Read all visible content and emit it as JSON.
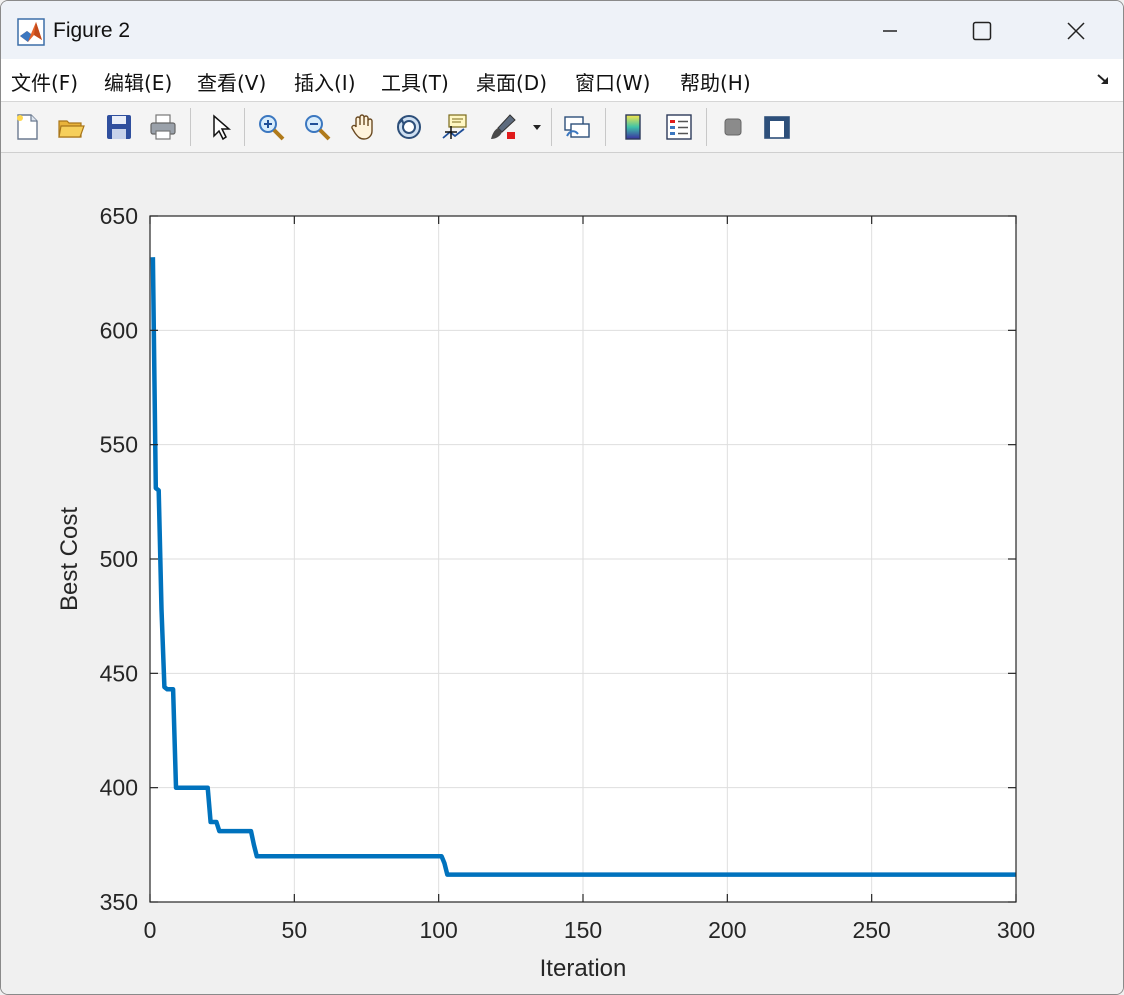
{
  "window": {
    "title": "Figure 2",
    "controls": {
      "minimize": "minimize-icon",
      "maximize": "maximize-icon",
      "close": "close-icon"
    }
  },
  "menu": {
    "items": [
      {
        "label": "文件(F)"
      },
      {
        "label": "编辑(E)"
      },
      {
        "label": "查看(V)"
      },
      {
        "label": "插入(I)"
      },
      {
        "label": "工具(T)"
      },
      {
        "label": "桌面(D)"
      },
      {
        "label": "窗口(W)"
      },
      {
        "label": "帮助(H)"
      }
    ]
  },
  "toolbar": {
    "icons": [
      "new-figure-icon",
      "open-file-icon",
      "save-icon",
      "print-icon",
      "select-arrow-icon",
      "zoom-in-icon",
      "zoom-out-icon",
      "pan-hand-icon",
      "rotate-3d-icon",
      "data-cursor-icon",
      "brush-icon",
      "link-plot-icon",
      "colorbar-icon",
      "legend-icon",
      "hide-plot-tools-icon",
      "show-plot-tools-icon"
    ]
  },
  "colors": {
    "line": "#0072bd",
    "grid": "#dedede",
    "axes": "#262626"
  },
  "chart_data": {
    "type": "line",
    "title": "",
    "xlabel": "Iteration",
    "ylabel": "Best Cost",
    "xlim": [
      0,
      300
    ],
    "ylim": [
      350,
      650
    ],
    "xticks": [
      0,
      50,
      100,
      150,
      200,
      250,
      300
    ],
    "yticks": [
      350,
      400,
      450,
      500,
      550,
      600,
      650
    ],
    "grid": true,
    "series": [
      {
        "x": [
          1,
          2,
          3,
          4,
          5,
          6,
          7,
          8,
          9,
          10,
          20,
          21,
          23,
          24,
          25,
          35,
          36,
          37,
          85,
          86,
          101,
          102,
          103,
          300
        ],
        "y": [
          632,
          531,
          530,
          478,
          444,
          443,
          443,
          443,
          400,
          400,
          400,
          385,
          385,
          381,
          381,
          381,
          375,
          370,
          370,
          370,
          370,
          367,
          362,
          362
        ]
      }
    ]
  }
}
